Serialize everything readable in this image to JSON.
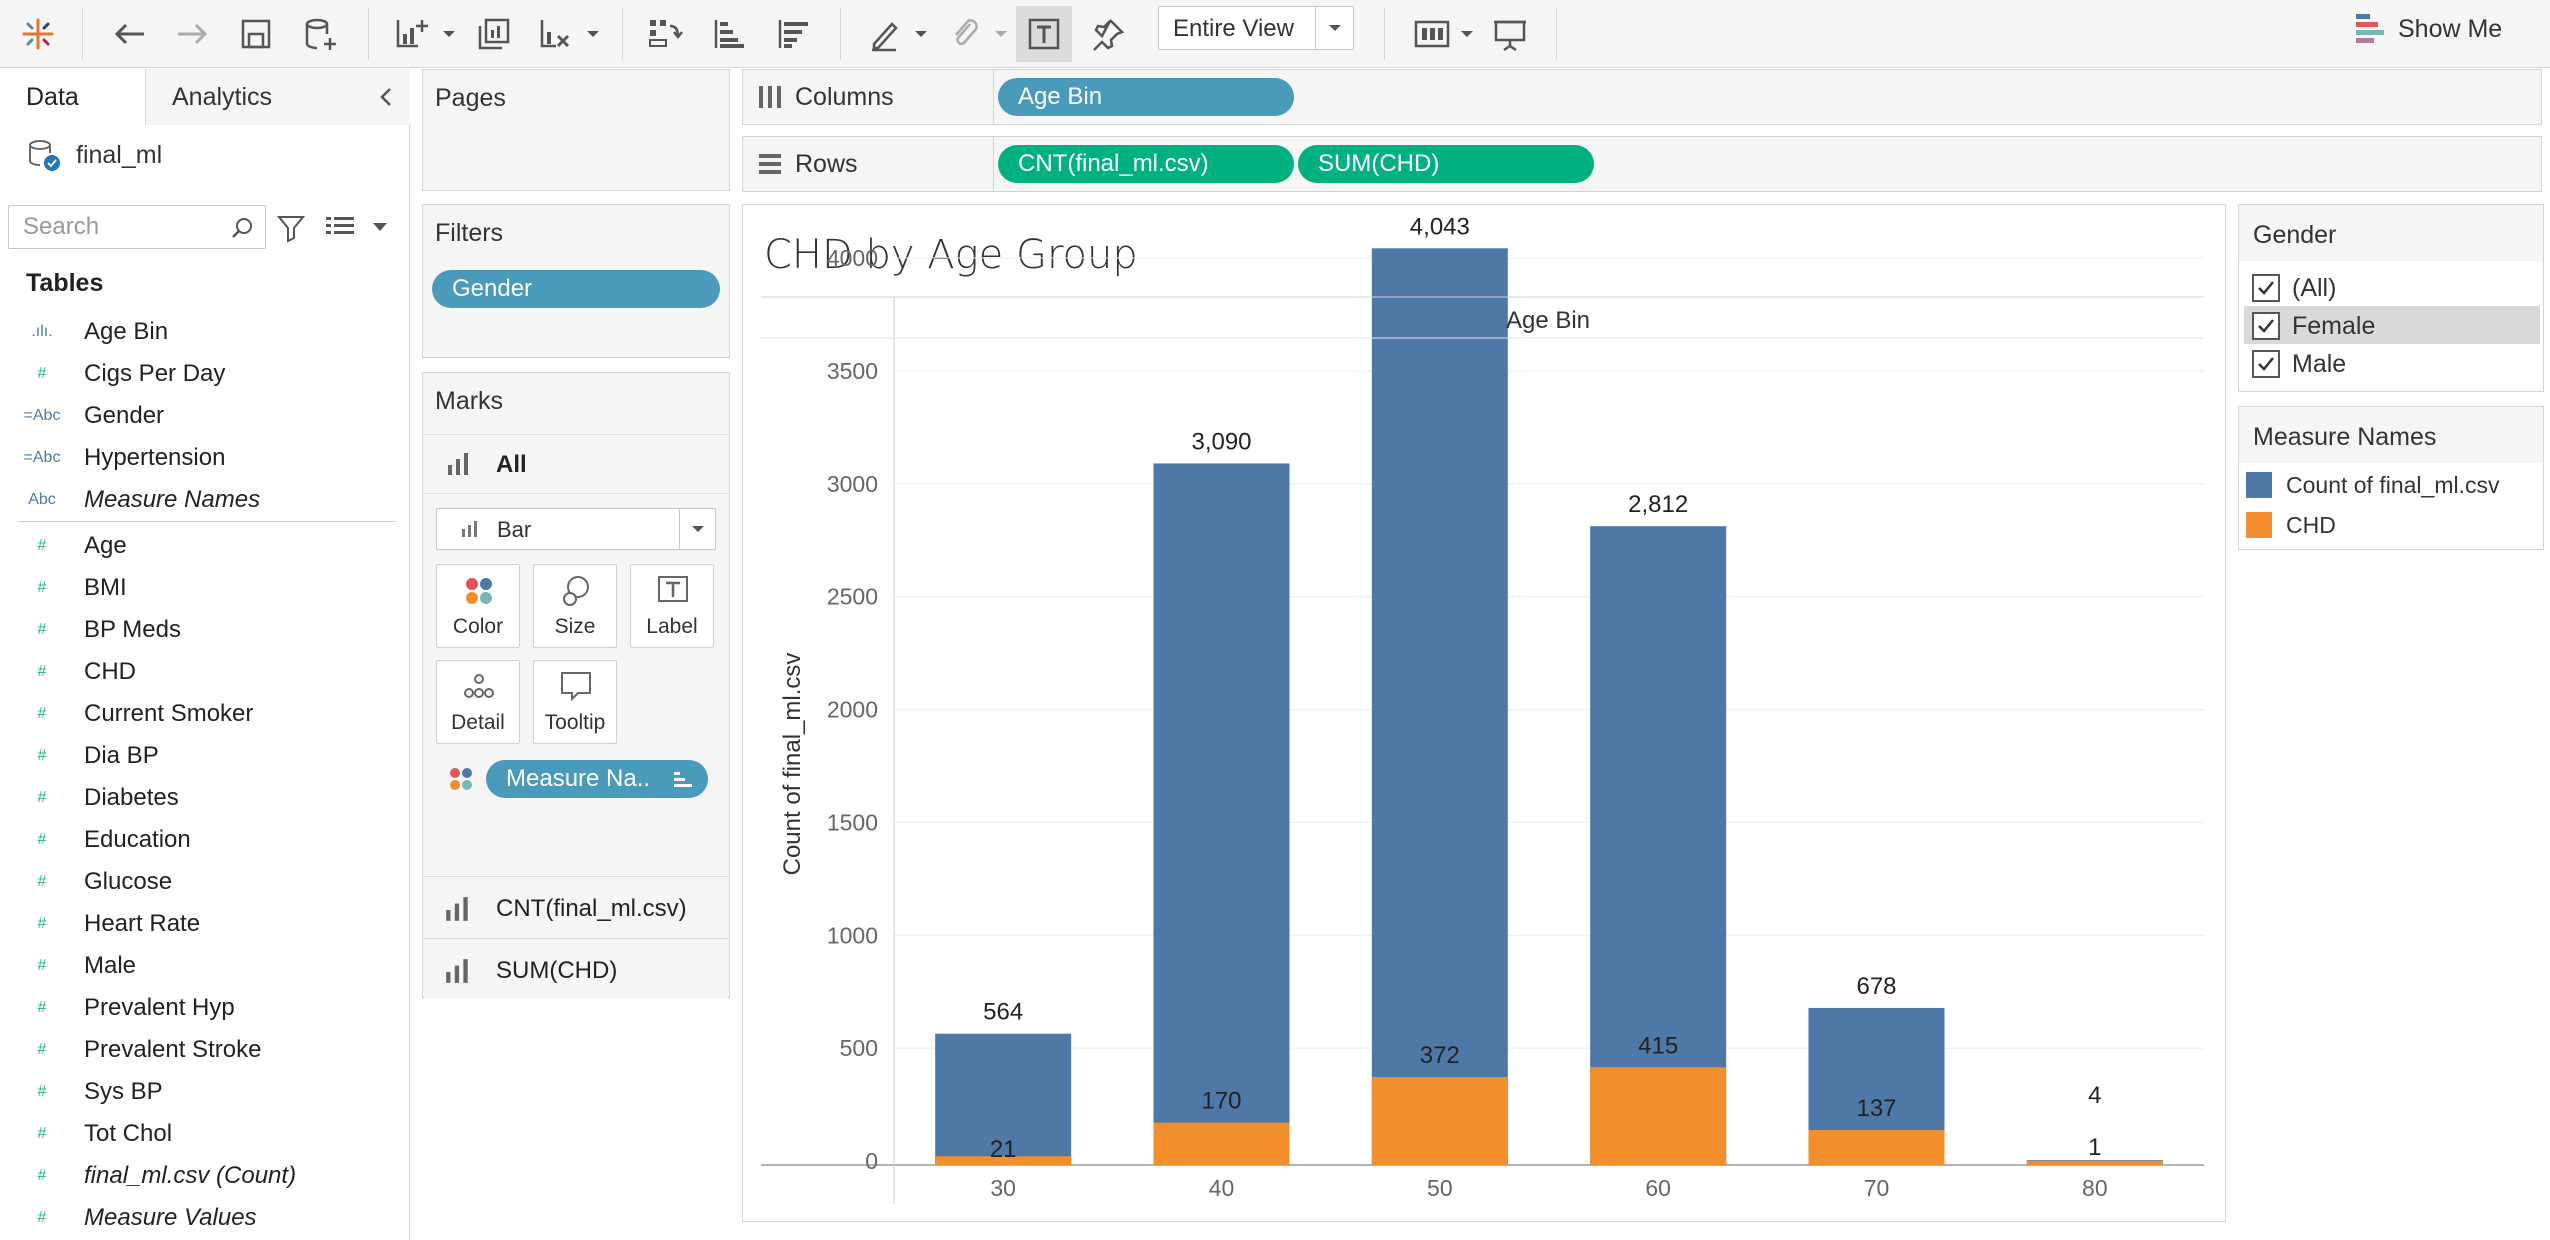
{
  "toolbar": {
    "fit_value": "Entire View",
    "show_me_label": "Show Me"
  },
  "data_pane": {
    "tab_data": "Data",
    "tab_analytics": "Analytics",
    "datasource_name": "final_ml",
    "search_placeholder": "Search",
    "tables_heading": "Tables",
    "dimensions": [
      {
        "icon": ".ılı.",
        "name": "Age Bin"
      },
      {
        "icon": "#",
        "name": "Cigs Per Day"
      },
      {
        "icon": "=Abc",
        "name": "Gender"
      },
      {
        "icon": "=Abc",
        "name": "Hypertension"
      },
      {
        "icon": "Abc",
        "name": "Measure Names"
      }
    ],
    "measures": [
      {
        "icon": "#",
        "name": "Age"
      },
      {
        "icon": "#",
        "name": "BMI"
      },
      {
        "icon": "#",
        "name": "BP Meds"
      },
      {
        "icon": "#",
        "name": "CHD"
      },
      {
        "icon": "#",
        "name": "Current Smoker"
      },
      {
        "icon": "#",
        "name": "Dia BP"
      },
      {
        "icon": "#",
        "name": "Diabetes"
      },
      {
        "icon": "#",
        "name": "Education"
      },
      {
        "icon": "#",
        "name": "Glucose"
      },
      {
        "icon": "#",
        "name": "Heart Rate"
      },
      {
        "icon": "#",
        "name": "Male"
      },
      {
        "icon": "#",
        "name": "Prevalent Hyp"
      },
      {
        "icon": "#",
        "name": "Prevalent Stroke"
      },
      {
        "icon": "#",
        "name": "Sys BP"
      },
      {
        "icon": "#",
        "name": "Tot Chol"
      },
      {
        "icon": "#",
        "name": "final_ml.csv (Count)"
      },
      {
        "icon": "#",
        "name": "Measure Values"
      }
    ]
  },
  "pages": {
    "title": "Pages"
  },
  "filters": {
    "title": "Filters",
    "pills": [
      "Gender"
    ]
  },
  "marks": {
    "title": "Marks",
    "all_label": "All",
    "mark_type": "Bar",
    "buttons": [
      "Color",
      "Size",
      "Label",
      "Detail",
      "Tooltip"
    ],
    "color_pill": "Measure Na..",
    "measure_rows": [
      "CNT(final_ml.csv)",
      "SUM(CHD)"
    ]
  },
  "shelves": {
    "columns_label": "Columns",
    "rows_label": "Rows",
    "columns_pills": [
      "Age Bin"
    ],
    "rows_pills": [
      "CNT(final_ml.csv)",
      "SUM(CHD)"
    ]
  },
  "viz": {
    "title": "CHD by Age Group",
    "header": "Age Bin"
  },
  "legend_gender": {
    "title": "Gender",
    "items": [
      {
        "label": "(All)",
        "checked": true
      },
      {
        "label": "Female",
        "checked": true
      },
      {
        "label": "Male",
        "checked": true
      }
    ]
  },
  "legend_measure": {
    "title": "Measure Names",
    "items": [
      {
        "label": "Count of final_ml.csv",
        "color": "#4e79a7"
      },
      {
        "label": "CHD",
        "color": "#f28e2b"
      }
    ]
  },
  "chart_data": {
    "type": "bar",
    "title": "CHD by Age Group",
    "xlabel": "Age Bin",
    "ylabel": "Count of final_ml.csv",
    "categories": [
      "30",
      "40",
      "50",
      "60",
      "70",
      "80"
    ],
    "series": [
      {
        "name": "Count of final_ml.csv",
        "values": [
          564,
          3090,
          4043,
          2812,
          678,
          4
        ],
        "color": "#4e79a7"
      },
      {
        "name": "CHD",
        "values": [
          21,
          170,
          372,
          415,
          137,
          1
        ],
        "color": "#f28e2b"
      }
    ],
    "data_labels": {
      "count": [
        "564",
        "3,090",
        "4,043",
        "2,812",
        "678",
        "4"
      ],
      "chd": [
        "21",
        "170",
        "372",
        "415",
        "137",
        "1"
      ]
    },
    "y_ticks": [
      0,
      500,
      1000,
      1500,
      2000,
      2500,
      3000,
      3500,
      4000
    ],
    "ylim": [
      0,
      4200
    ],
    "grid": true,
    "legend": "right"
  }
}
